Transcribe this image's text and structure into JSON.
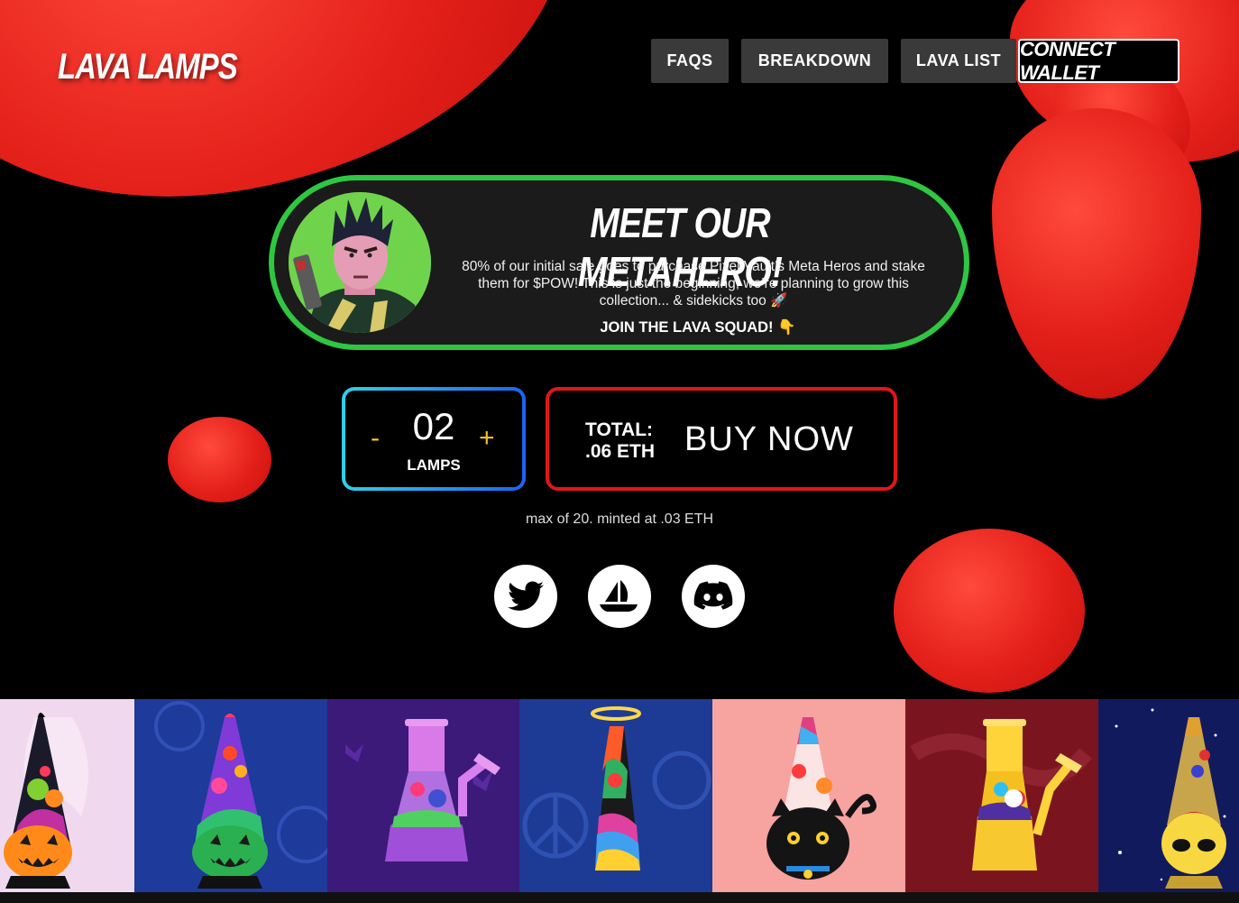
{
  "header": {
    "logo": "LAVA LAMPS",
    "nav": [
      {
        "label": "FAQS"
      },
      {
        "label": "BREAKDOWN"
      },
      {
        "label": "LAVA LIST"
      }
    ],
    "connect_label": "CONNECT WALLET"
  },
  "hero": {
    "title": "MEET OUR METAHERO!",
    "body": "80% of our initial sale goes to purchase Pixel Vault’s Meta Heros and stake them for $POW!  This is just the beginning, we’re planning to grow this collection... & sidekicks too 🚀",
    "cta": "JOIN THE LAVA SQUAD! 👇"
  },
  "mint": {
    "decrement": "-",
    "increment": "+",
    "quantity": "02",
    "unit": "LAMPS",
    "total_label": "TOTAL:",
    "total_value": ".06 ETH",
    "buy_label": "BUY NOW",
    "note": "max of 20.  minted at .03 ETH"
  },
  "socials": [
    {
      "icon": "twitter-icon"
    },
    {
      "icon": "opensea-icon"
    },
    {
      "icon": "discord-icon"
    }
  ],
  "colors": {
    "lava_red": "#e4201a",
    "hero_border": "#2fc742",
    "buy_border": "#e01717",
    "qty_gradient_start": "#2fd1e8",
    "qty_gradient_end": "#1c63f2",
    "accent_yellow": "#f5c025"
  },
  "gallery": [
    {
      "theme": "halloween-lamp",
      "bg": "#f0d9ee"
    },
    {
      "theme": "yin-yang-lamp",
      "bg": "#1e3a9a"
    },
    {
      "theme": "purple-bong-lamp",
      "bg": "#3b1a7a"
    },
    {
      "theme": "halo-peace-lamp",
      "bg": "#1d3b95"
    },
    {
      "theme": "black-cat-lamp",
      "bg": "#f7a3a0"
    },
    {
      "theme": "gold-bong-lamp",
      "bg": "#7a1520"
    },
    {
      "theme": "alien-space-lamp",
      "bg": "#121a5e"
    }
  ]
}
